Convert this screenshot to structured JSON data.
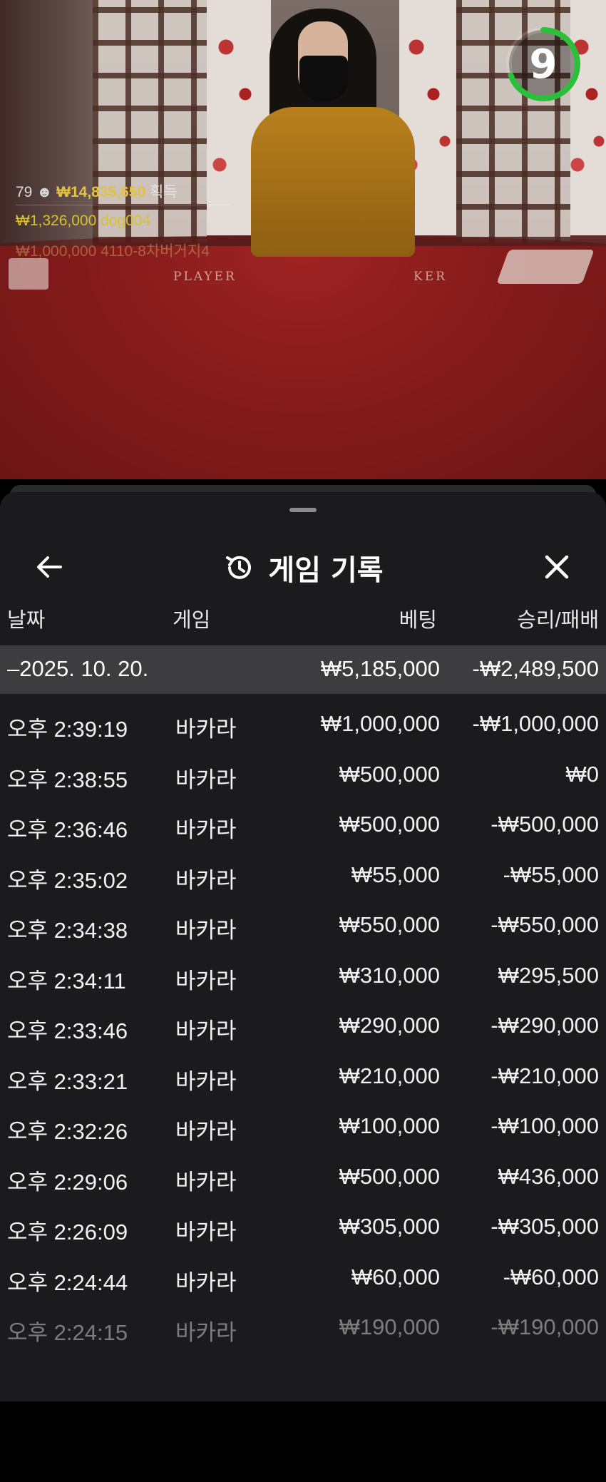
{
  "video": {
    "timer_value": "9",
    "table_labels": [
      "PLAYER",
      "KER"
    ],
    "ticker": {
      "line1_count": "79",
      "line1_amount": "₩14,835,650",
      "line1_label": "획득",
      "line2": "₩1,326,000  dog004",
      "line3": "₩1,000,000  4110-8차버거지4"
    }
  },
  "sheet": {
    "title": "게임 기록",
    "columns": {
      "date": "날짜",
      "game": "게임",
      "bet": "베팅",
      "result": "승리/패배"
    },
    "summary": {
      "date": "–2025. 10. 20.",
      "bet": "₩5,185,000",
      "result": "-₩2,489,500"
    },
    "rows": [
      {
        "time": "오후 2:39:19",
        "game": "바카라",
        "bet": "₩1,000,000",
        "result": "-₩1,000,000"
      },
      {
        "time": "오후 2:38:55",
        "game": "바카라",
        "bet": "₩500,000",
        "result": "₩0"
      },
      {
        "time": "오후 2:36:46",
        "game": "바카라",
        "bet": "₩500,000",
        "result": "-₩500,000"
      },
      {
        "time": "오후 2:35:02",
        "game": "바카라",
        "bet": "₩55,000",
        "result": "-₩55,000"
      },
      {
        "time": "오후 2:34:38",
        "game": "바카라",
        "bet": "₩550,000",
        "result": "-₩550,000"
      },
      {
        "time": "오후 2:34:11",
        "game": "바카라",
        "bet": "₩310,000",
        "result": "₩295,500"
      },
      {
        "time": "오후 2:33:46",
        "game": "바카라",
        "bet": "₩290,000",
        "result": "-₩290,000"
      },
      {
        "time": "오후 2:33:21",
        "game": "바카라",
        "bet": "₩210,000",
        "result": "-₩210,000"
      },
      {
        "time": "오후 2:32:26",
        "game": "바카라",
        "bet": "₩100,000",
        "result": "-₩100,000"
      },
      {
        "time": "오후 2:29:06",
        "game": "바카라",
        "bet": "₩500,000",
        "result": "₩436,000"
      },
      {
        "time": "오후 2:26:09",
        "game": "바카라",
        "bet": "₩305,000",
        "result": "-₩305,000"
      },
      {
        "time": "오후 2:24:44",
        "game": "바카라",
        "bet": "₩60,000",
        "result": "-₩60,000"
      },
      {
        "time": "오후 2:24:15",
        "game": "바카라",
        "bet": "₩190,000",
        "result": "-₩190,000"
      }
    ]
  },
  "colors": {
    "timer_ring": "#2bbf3a",
    "sheet_bg": "#1b1b1d",
    "summary_bg": "#3d3d3f",
    "ticker_gold": "#e3c23d"
  }
}
